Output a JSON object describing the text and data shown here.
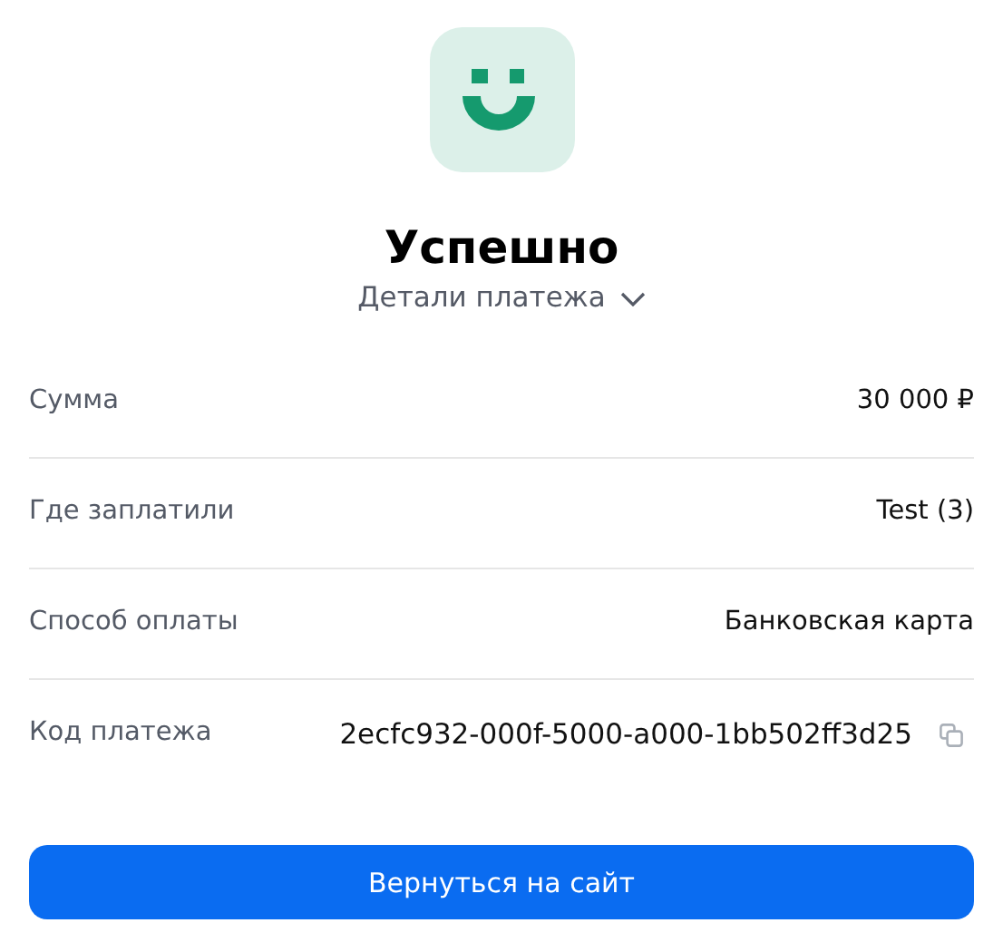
{
  "status": {
    "title": "Успешно",
    "details_toggle": "Детали платежа",
    "expanded": false
  },
  "details": [
    {
      "kind": "plain",
      "label": "Сумма",
      "value": "30 000 ₽"
    },
    {
      "kind": "plain",
      "label": "Где заплатили",
      "value": "Test (3)"
    },
    {
      "kind": "plain",
      "label": "Способ оплаты",
      "value": "Банковская карта"
    },
    {
      "kind": "copyable",
      "label": "Код платежа",
      "value": "2ecfc932-000f-5000-a000-1bb502ff3d25"
    }
  ],
  "button": "Вернуться на сайт"
}
